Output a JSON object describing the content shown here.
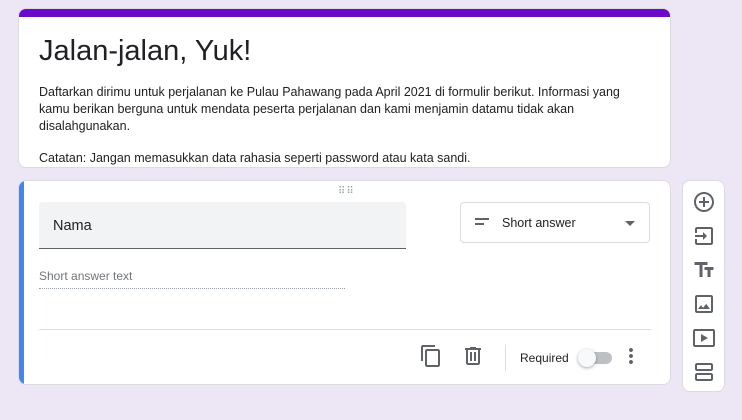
{
  "form": {
    "title": "Jalan-jalan, Yuk!",
    "description": "Daftarkan dirimu untuk perjalanan ke Pulau Pahawang pada April 2021 di formulir berikut. Informasi yang kamu berikan berguna untuk mendata peserta perjalanan dan kami menjamin datamu tidak akan disalahgunakan.",
    "note": "Catatan: Jangan memasukkan data rahasia seperti password atau kata sandi."
  },
  "question": {
    "title": "Nama",
    "type_label": "Short answer",
    "answer_placeholder": "Short answer text",
    "required_label": "Required",
    "required": false
  },
  "icons": {
    "drag": "drag-handle-icon",
    "type": "short-text-icon",
    "caret": "dropdown-caret-icon",
    "copy": "duplicate-icon",
    "delete": "trash-icon",
    "more": "more-vert-icon",
    "toolbar": [
      "add-circle-icon",
      "import-icon",
      "title-text-icon",
      "image-icon",
      "video-icon",
      "section-icon"
    ]
  },
  "colors": {
    "accent": "#6b0ac8",
    "active_question": "#4285f4",
    "background": "#ece6f5"
  }
}
